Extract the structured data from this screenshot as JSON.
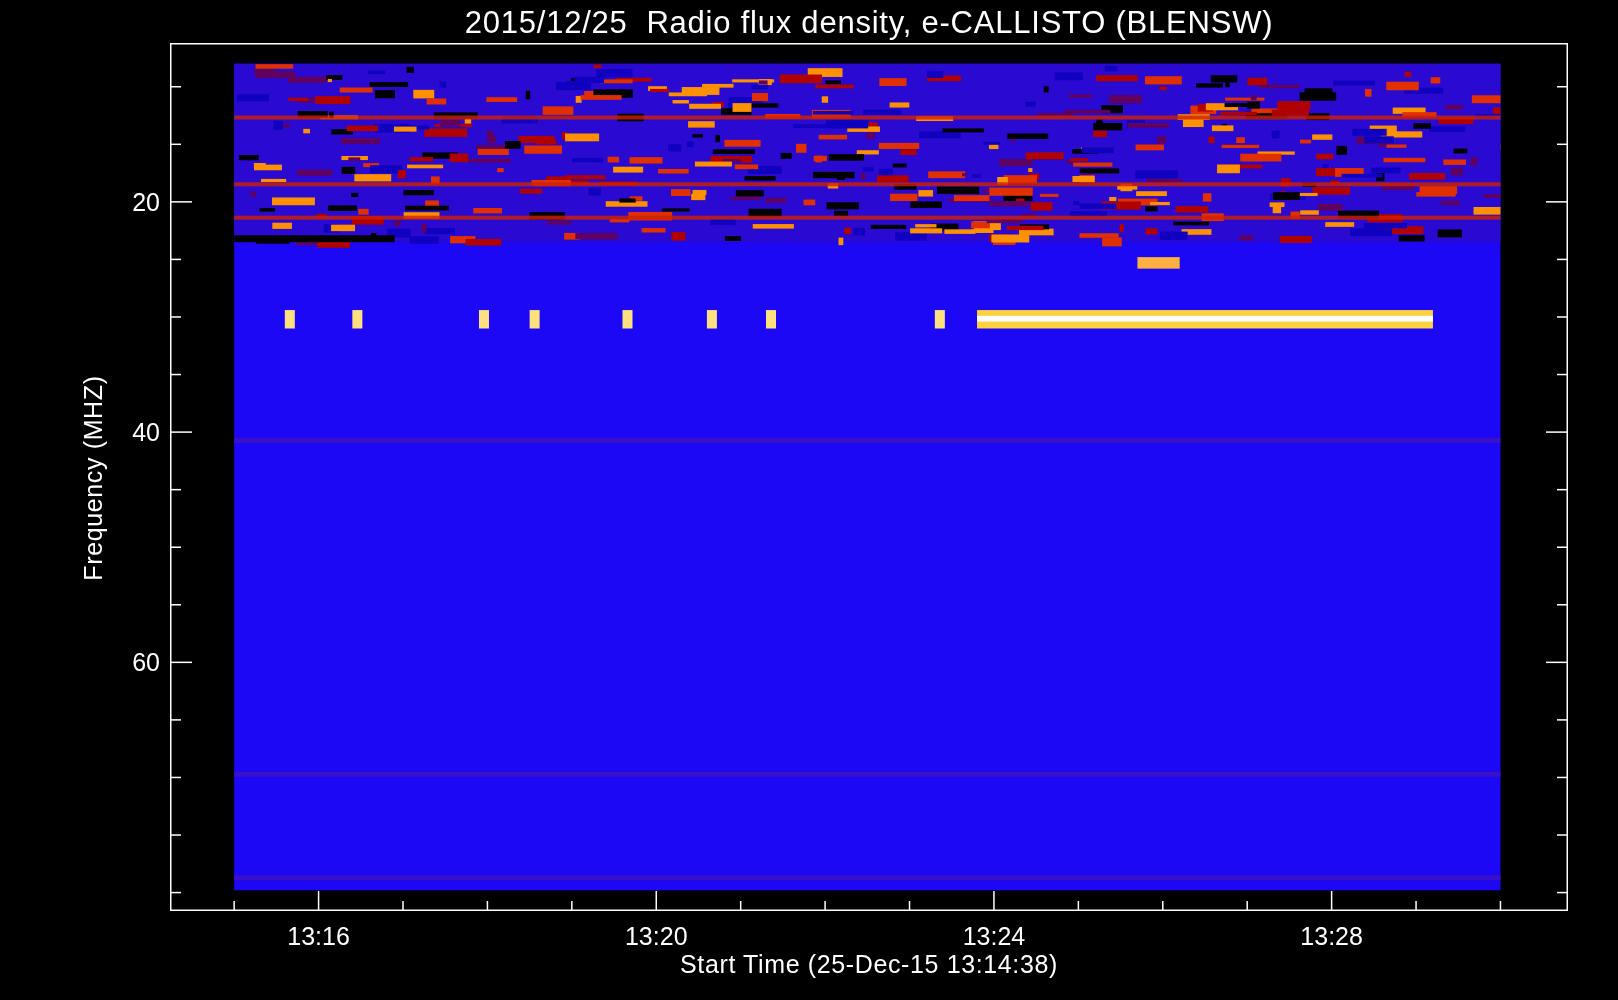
{
  "title": "2015/12/25  Radio flux density, e-CALLISTO (BLENSW)",
  "y_axis": {
    "label": "Frequency (MHZ)",
    "tick_labels": [
      "20",
      "40",
      "60"
    ]
  },
  "x_axis": {
    "label": "Start Time (25-Dec-15 13:14:38)",
    "tick_labels": [
      "13:16",
      "13:20",
      "13:24",
      "13:28"
    ]
  }
}
